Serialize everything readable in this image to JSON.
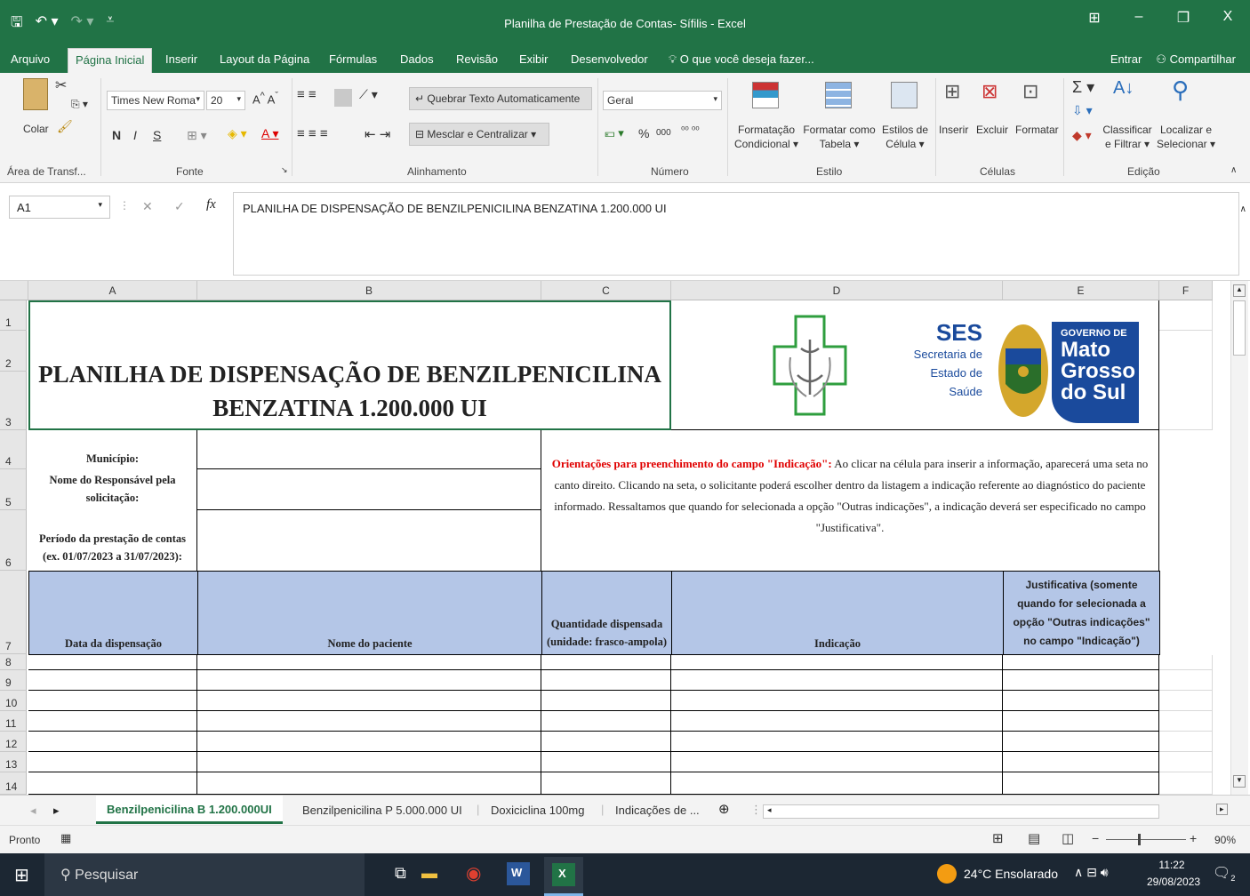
{
  "window": {
    "title": "Planilha de Prestação de Contas- Sífilis - Excel",
    "minimize": "–",
    "restore": "❐",
    "close": "X",
    "display_options": "⊞"
  },
  "menu": {
    "tabs": [
      "Arquivo",
      "Página Inicial",
      "Inserir",
      "Layout da Página",
      "Fórmulas",
      "Dados",
      "Revisão",
      "Exibir",
      "Desenvolvedor"
    ],
    "active_tab": "Página Inicial",
    "tell_me": "O que você deseja fazer...",
    "signin": "Entrar",
    "share": "Compartilhar"
  },
  "ribbon": {
    "clipboard": {
      "paste": "Colar",
      "group": "Área de Transf..."
    },
    "font": {
      "name": "Times New Roma",
      "size": "20",
      "bold": "N",
      "italic": "I",
      "underline": "S",
      "group": "Fonte"
    },
    "alignment": {
      "wrap": "Quebrar Texto Automaticamente",
      "merge": "Mesclar e Centralizar",
      "group": "Alinhamento"
    },
    "number": {
      "format": "Geral",
      "percent": "%",
      "thousands": "000",
      "group": "Número"
    },
    "styles": {
      "conditional_1": "Formatação",
      "conditional_2": "Condicional",
      "table_1": "Formatar como",
      "table_2": "Tabela",
      "cell_1": "Estilos de",
      "cell_2": "Célula",
      "group": "Estilo"
    },
    "cells": {
      "insert": "Inserir",
      "delete": "Excluir",
      "format": "Formatar",
      "group": "Células"
    },
    "editing": {
      "sort_1": "Classificar",
      "sort_2": "e Filtrar",
      "find_1": "Localizar e",
      "find_2": "Selecionar",
      "group": "Edição"
    }
  },
  "formula_bar": {
    "name_box": "A1",
    "formula": "PLANILHA DE DISPENSAÇÃO DE BENZILPENICILINA BENZATINA 1.200.000 UI"
  },
  "grid": {
    "columns": [
      "A",
      "B",
      "C",
      "D",
      "E",
      "F"
    ],
    "rows": [
      "1",
      "2",
      "3",
      "4",
      "5",
      "6",
      "7",
      "8",
      "9",
      "10",
      "11",
      "12",
      "13",
      "14"
    ],
    "title_line1": "PLANILHA DE DISPENSAÇÃO DE BENZILPENICILINA",
    "title_line2": "BENZATINA 1.200.000 UI",
    "logo": {
      "ses": "SES",
      "sec1": "Secretaria de",
      "sec2": "Estado de",
      "sec3": "Saúde",
      "gov": "GOVERNO DE",
      "mato": "Mato",
      "grosso": "Grosso",
      "dosul": "do Sul"
    },
    "labels": {
      "municipio": "Município:",
      "responsavel": "Nome do Responsável pela solicitação:",
      "periodo_1": "Período da prestação de contas",
      "periodo_2": "(ex. 01/07/2023 a 31/07/2023):"
    },
    "orientation_title": "Orientações para preenchimento do campo \"Indicação\":",
    "orientation_text": "Ao clicar na célula para inserir a informação, aparecerá uma seta no canto direito. Clicando na seta, o solicitante poderá escolher dentro da listagem a indicação referente ao diagnóstico do paciente informado. Ressaltamos que quando for selecionada a opção \"Outras indicações\", a indicação deverá ser especificado no campo \"Justificativa\".",
    "table_headers": [
      "Data da dispensação",
      "Nome do paciente",
      "Quantidade dispensada (unidade: frasco-ampola)",
      "Indicação",
      "Justificativa (somente quando for selecionada a opção \"Outras indicações\" no campo \"Indicação\")"
    ]
  },
  "sheets": [
    "Benzilpenicilina B 1.200.000UI",
    "Benzilpenicilina P 5.000.000 UI",
    "Doxiciclina 100mg",
    "Indicações de ..."
  ],
  "active_sheet": "Benzilpenicilina B 1.200.000UI",
  "status": {
    "ready": "Pronto",
    "zoom": "90%"
  },
  "taskbar": {
    "search": "Pesquisar",
    "weather": "24°C  Ensolarado",
    "time": "11:22",
    "date": "29/08/2023",
    "notifications": "2"
  },
  "colors": {
    "excel_green": "#217346",
    "header_blue": "#b4c6e7",
    "orientation_red": "#e00000"
  }
}
